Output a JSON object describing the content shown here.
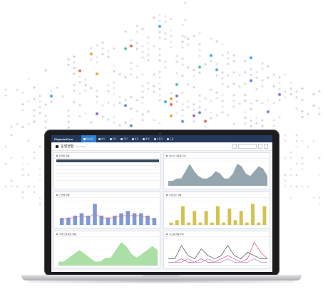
{
  "app": {
    "brand": "PinpointCore",
    "nav": [
      {
        "label": "대시보드",
        "active": true
      },
      {
        "label": "분석",
        "active": false
      },
      {
        "label": "장비",
        "active": false
      },
      {
        "label": "관리",
        "active": false
      },
      {
        "label": "설정",
        "active": false
      },
      {
        "label": "통계",
        "active": false
      },
      {
        "label": "사용자",
        "active": false
      },
      {
        "label": "도움",
        "active": false
      }
    ],
    "accent": "#2f7fd1",
    "topbar_color": "#243a5c"
  },
  "page": {
    "title": "운영현황",
    "subtitle": "Summary",
    "controls": [
      "",
      "",
      "",
      ""
    ]
  },
  "panels": {
    "table": {
      "title": "트래픽 현황",
      "headers": [
        "",
        "",
        "",
        "",
        "",
        "",
        "",
        "",
        ""
      ],
      "rows": [
        [
          "",
          "",
          "",
          "",
          "",
          "",
          "",
          "",
          ""
        ],
        [
          "",
          "",
          "",
          "",
          "",
          "",
          "",
          "",
          ""
        ],
        [
          "",
          "",
          "",
          "",
          "",
          "",
          "",
          "",
          ""
        ],
        [
          "",
          "",
          "",
          "",
          "",
          "",
          "",
          "",
          ""
        ],
        [
          "",
          "",
          "",
          "",
          "",
          "",
          "",
          "",
          ""
        ]
      ]
    },
    "area_top": {
      "title": "실시간 사용량 추이"
    },
    "bars_mixed": {
      "title": "기간별 현황"
    },
    "bars_yellow": {
      "title": "요청건수 현황"
    },
    "area_green": {
      "title": "서비스별 응답 현황"
    },
    "lines_multi": {
      "title": "시스템 현황 추이"
    }
  },
  "chart_data": [
    {
      "type": "area",
      "values": [
        2,
        2,
        3,
        3,
        6,
        9,
        6,
        4,
        3,
        3,
        4,
        6,
        5,
        3,
        3,
        5,
        9,
        8,
        5,
        4,
        6,
        8,
        7,
        4
      ],
      "color": "#8fa1ab"
    },
    {
      "type": "bar",
      "categories": [
        "1",
        "2",
        "3",
        "4",
        "5",
        "6",
        "7",
        "8",
        "9",
        "10",
        "11",
        "12",
        "13",
        "14",
        "15"
      ],
      "series": [
        {
          "values": [
            3,
            3,
            4,
            5,
            4,
            9,
            4,
            3,
            4,
            5,
            6,
            5,
            5,
            4,
            3
          ],
          "color": "#7f9ad8"
        }
      ],
      "line": [
        2,
        3,
        3,
        4,
        3,
        5,
        3,
        3,
        3,
        4,
        4,
        4,
        4,
        3,
        2
      ],
      "line_color": "#d96d6d"
    },
    {
      "type": "bar",
      "values": [
        1,
        2,
        8,
        1,
        6,
        1,
        6,
        1,
        8,
        1,
        7,
        2,
        6,
        1,
        9,
        1,
        8
      ],
      "color": "#d4c24f"
    },
    {
      "type": "area",
      "values": [
        1,
        1,
        2,
        3,
        4,
        3,
        2,
        1,
        1,
        2,
        2,
        4,
        6,
        5,
        3,
        2,
        3,
        4,
        5,
        4
      ],
      "color": "#a6dda1"
    },
    {
      "type": "line",
      "series": [
        {
          "values": [
            2,
            2,
            6,
            3,
            2,
            5,
            3,
            2,
            3,
            6,
            3,
            2,
            4,
            3,
            2,
            2
          ],
          "color": "#333333"
        },
        {
          "values": [
            1,
            1,
            2,
            1,
            1,
            2,
            1,
            1,
            2,
            3,
            2,
            1,
            2,
            7,
            4,
            2
          ],
          "color": "#d9336c"
        },
        {
          "values": [
            1,
            1,
            1,
            2,
            1,
            1,
            2,
            1,
            1,
            2,
            1,
            1,
            1,
            2,
            1,
            1
          ],
          "color": "#a07bd4"
        }
      ]
    }
  ]
}
